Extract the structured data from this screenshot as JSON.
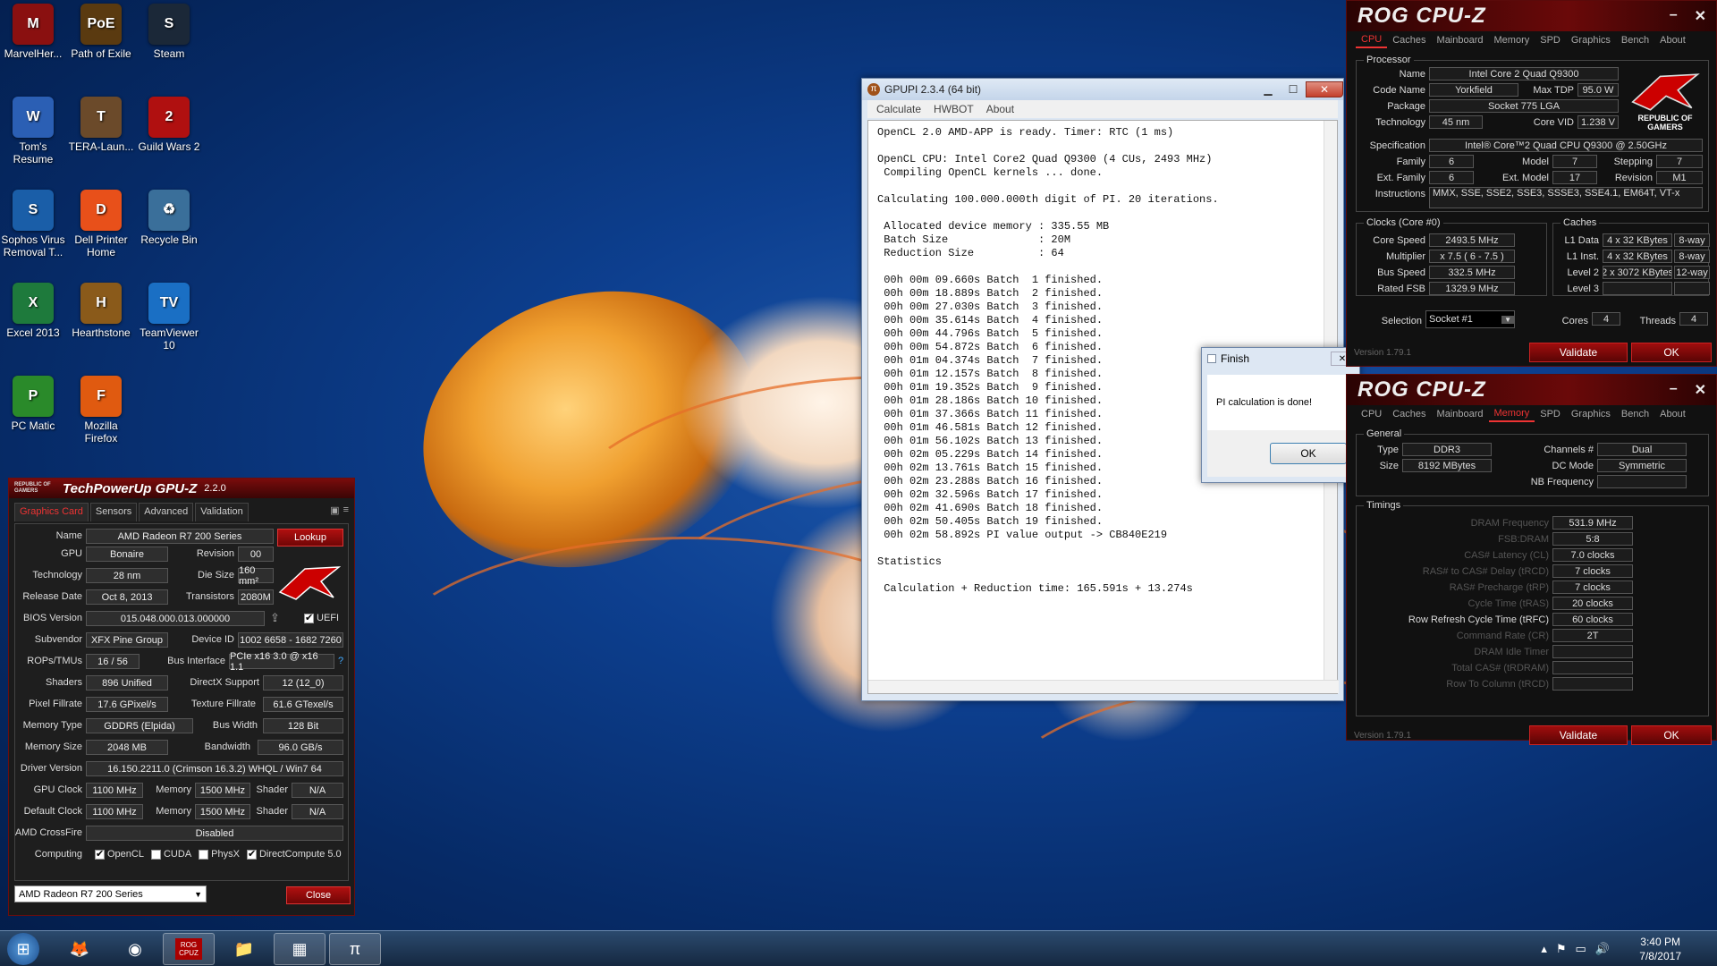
{
  "desktop": {
    "icons": [
      {
        "label": "MarvelHer...",
        "color": "#8a1010",
        "glyph": "M"
      },
      {
        "label": "Path of Exile",
        "color": "#5a3a10",
        "glyph": "PoE"
      },
      {
        "label": "Steam",
        "color": "#1b2838",
        "glyph": "S"
      },
      {
        "label": "Tom's Resume",
        "color": "#2b5fb4",
        "glyph": "W"
      },
      {
        "label": "TERA-Laun...",
        "color": "#6b4a2a",
        "glyph": "T"
      },
      {
        "label": "Guild Wars 2",
        "color": "#b01010",
        "glyph": "2"
      },
      {
        "label": "Sophos Virus Removal T...",
        "color": "#1a5ea8",
        "glyph": "S"
      },
      {
        "label": "Dell Printer Home",
        "color": "#e8501a",
        "glyph": "D"
      },
      {
        "label": "Recycle Bin",
        "color": "#3a6f9a",
        "glyph": "♻"
      },
      {
        "label": "Excel 2013",
        "color": "#1e7a3c",
        "glyph": "X"
      },
      {
        "label": "Hearthstone",
        "color": "#8a5a1a",
        "glyph": "H"
      },
      {
        "label": "TeamViewer 10",
        "color": "#1a6fc4",
        "glyph": "TV"
      },
      {
        "label": "PC Matic",
        "color": "#2a8a2a",
        "glyph": "P"
      },
      {
        "label": "Mozilla Firefox",
        "color": "#e05a10",
        "glyph": "F"
      }
    ]
  },
  "gpuz": {
    "title": "TechPowerUp GPU-Z",
    "version": "2.2.0",
    "rog": "REPUBLIC OF GAMERS",
    "tabs": [
      "Graphics Card",
      "Sensors",
      "Advanced",
      "Validation"
    ],
    "lookup": "Lookup",
    "name_label": "Name",
    "name": "AMD Radeon R7 200 Series",
    "gpu_label": "GPU",
    "gpu": "Bonaire",
    "revision_label": "Revision",
    "revision": "00",
    "tech_label": "Technology",
    "tech": "28 nm",
    "die_label": "Die Size",
    "die": "160 mm²",
    "release_label": "Release Date",
    "release": "Oct 8, 2013",
    "trans_label": "Transistors",
    "trans": "2080M",
    "bios_label": "BIOS Version",
    "bios": "015.048.000.013.000000",
    "uefi": "UEFI",
    "subvendor_label": "Subvendor",
    "subvendor": "XFX Pine Group",
    "devid_label": "Device ID",
    "devid": "1002 6658 - 1682 7260",
    "rops_label": "ROPs/TMUs",
    "rops": "16 / 56",
    "bus_label": "Bus Interface",
    "bus": "PCIe x16 3.0 @ x16 1.1",
    "bus_q": "?",
    "shaders_label": "Shaders",
    "shaders": "896 Unified",
    "dx_label": "DirectX Support",
    "dx": "12 (12_0)",
    "pixel_label": "Pixel Fillrate",
    "pixel": "17.6 GPixel/s",
    "tex_label": "Texture Fillrate",
    "tex": "61.6 GTexel/s",
    "memtype_label": "Memory Type",
    "memtype": "GDDR5 (Elpida)",
    "buswidth_label": "Bus Width",
    "buswidth": "128 Bit",
    "memsize_label": "Memory Size",
    "memsize": "2048 MB",
    "bandwidth_label": "Bandwidth",
    "bandwidth": "96.0 GB/s",
    "driver_label": "Driver Version",
    "driver": "16.150.2211.0 (Crimson 16.3.2) WHQL / Win7 64",
    "gpuclock_label": "GPU Clock",
    "gpuclock": "1100 MHz",
    "mem_label": "Memory",
    "gpumem": "1500 MHz",
    "shader_label": "Shader",
    "shader": "N/A",
    "defclock_label": "Default Clock",
    "defclock": "1100 MHz",
    "defmem": "1500 MHz",
    "defshader": "N/A",
    "crossfire_label": "AMD CrossFire",
    "crossfire": "Disabled",
    "computing_label": "Computing",
    "opencl": "OpenCL",
    "cuda": "CUDA",
    "physx": "PhysX",
    "dc": "DirectCompute 5.0",
    "select": "AMD Radeon R7 200 Series",
    "close": "Close"
  },
  "gpupi": {
    "title": "GPUPI 2.3.4 (64 bit)",
    "menu": [
      "Calculate",
      "HWBOT",
      "About"
    ],
    "lines": [
      "OpenCL 2.0 AMD-APP is ready. Timer: RTC (1 ms)",
      "",
      "OpenCL CPU: Intel Core2 Quad Q9300 (4 CUs, 2493 MHz)",
      " Compiling OpenCL kernels ... done.",
      "",
      "Calculating 100.000.000th digit of PI. 20 iterations.",
      "",
      " Allocated device memory : 335.55 MB",
      " Batch Size              : 20M",
      " Reduction Size          : 64",
      "",
      " 00h 00m 09.660s Batch  1 finished.",
      " 00h 00m 18.889s Batch  2 finished.",
      " 00h 00m 27.030s Batch  3 finished.",
      " 00h 00m 35.614s Batch  4 finished.",
      " 00h 00m 44.796s Batch  5 finished.",
      " 00h 00m 54.872s Batch  6 finished.",
      " 00h 01m 04.374s Batch  7 finished.",
      " 00h 01m 12.157s Batch  8 finished.",
      " 00h 01m 19.352s Batch  9 finished.",
      " 00h 01m 28.186s Batch 10 finished.",
      " 00h 01m 37.366s Batch 11 finished.",
      " 00h 01m 46.581s Batch 12 finished.",
      " 00h 01m 56.102s Batch 13 finished.",
      " 00h 02m 05.229s Batch 14 finished.",
      " 00h 02m 13.761s Batch 15 finished.",
      " 00h 02m 23.288s Batch 16 finished.",
      " 00h 02m 32.596s Batch 17 finished.",
      " 00h 02m 41.690s Batch 18 finished.",
      " 00h 02m 50.405s Batch 19 finished.",
      " 00h 02m 58.892s PI value output -> CB840E219",
      "",
      "Statistics",
      "",
      " Calculation + Reduction time: 165.591s + 13.274s"
    ]
  },
  "finish": {
    "title": "Finish",
    "message": "PI calculation is done!",
    "ok": "OK"
  },
  "cpuz1": {
    "title": "ROG CPU-Z",
    "tabs": [
      "CPU",
      "Caches",
      "Mainboard",
      "Memory",
      "SPD",
      "Graphics",
      "Bench",
      "About"
    ],
    "processor": "Processor",
    "name_label": "Name",
    "name": "Intel Core 2 Quad Q9300",
    "code_label": "Code Name",
    "code": "Yorkfield",
    "tdp_label": "Max TDP",
    "tdp": "95.0 W",
    "pkg_label": "Package",
    "pkg": "Socket 775 LGA",
    "tech_label": "Technology",
    "tech": "45 nm",
    "vid_label": "Core VID",
    "vid": "1.238 V",
    "spec_label": "Specification",
    "spec": "Intel® Core™2 Quad  CPU   Q9300  @ 2.50GHz",
    "family_label": "Family",
    "family": "6",
    "model_label": "Model",
    "model": "7",
    "stepping_label": "Stepping",
    "stepping": "7",
    "extfam_label": "Ext. Family",
    "extfam": "6",
    "extmodel_label": "Ext. Model",
    "extmodel": "17",
    "rev_label": "Revision",
    "rev": "M1",
    "instr_label": "Instructions",
    "instr": "MMX, SSE, SSE2, SSE3, SSSE3, SSE4.1, EM64T, VT-x",
    "clocks": "Clocks (Core #0)",
    "corespeed_label": "Core Speed",
    "corespeed": "2493.5 MHz",
    "mult_label": "Multiplier",
    "mult": "x 7.5 ( 6 - 7.5 )",
    "busspeed_label": "Bus Speed",
    "busspeed": "332.5 MHz",
    "fsb_label": "Rated FSB",
    "fsb": "1329.9 MHz",
    "caches": "Caches",
    "l1d_label": "L1 Data",
    "l1d": "4 x 32 KBytes",
    "l1d_way": "8-way",
    "l1i_label": "L1 Inst.",
    "l1i": "4 x 32 KBytes",
    "l1i_way": "8-way",
    "l2_label": "Level 2",
    "l2": "2 x 3072 KBytes",
    "l2_way": "12-way",
    "l3_label": "Level 3",
    "sel_label": "Selection",
    "sel": "Socket #1",
    "cores_label": "Cores",
    "cores": "4",
    "threads_label": "Threads",
    "threads": "4",
    "version": "Version 1.79.1",
    "validate": "Validate",
    "ok": "OK",
    "rog_text": "REPUBLIC OF GAMERS"
  },
  "cpuz2": {
    "title": "ROG CPU-Z",
    "general": "General",
    "type_label": "Type",
    "type": "DDR3",
    "channels_label": "Channels #",
    "channels": "Dual",
    "size_label": "Size",
    "size": "8192 MBytes",
    "dcmode_label": "DC Mode",
    "dcmode": "Symmetric",
    "nb_label": "NB Frequency",
    "timings": "Timings",
    "dram_label": "DRAM Frequency",
    "dram": "531.9 MHz",
    "fsbdram_label": "FSB:DRAM",
    "fsbdram": "5:8",
    "cl_label": "CAS# Latency (CL)",
    "cl": "7.0 clocks",
    "trcd_label": "RAS# to CAS# Delay (tRCD)",
    "trcd": "7 clocks",
    "trp_label": "RAS# Precharge (tRP)",
    "trp": "7 clocks",
    "tras_label": "Cycle Time (tRAS)",
    "tras": "20 clocks",
    "trfc_label": "Row Refresh Cycle Time (tRFC)",
    "trfc": "60 clocks",
    "cr_label": "Command Rate (CR)",
    "cr": "2T",
    "idle_label": "DRAM Idle Timer",
    "trdram_label": "Total CAS# (tRDRAM)",
    "trcd2_label": "Row To Column (tRCD)",
    "version": "Version 1.79.1",
    "validate": "Validate",
    "ok": "OK"
  },
  "taskbar": {
    "time": "3:40 PM",
    "date": "7/8/2017",
    "cpuz_icon": "ROG CPUZ"
  }
}
